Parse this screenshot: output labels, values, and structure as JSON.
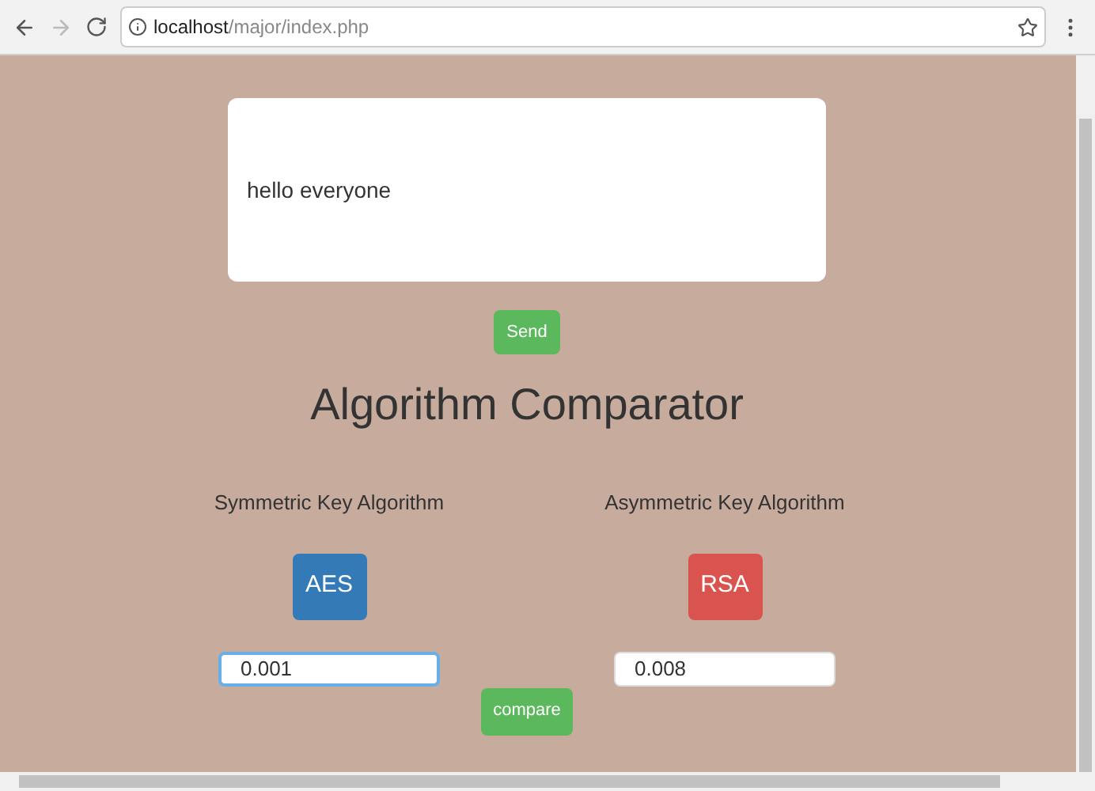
{
  "browser": {
    "url_host": "localhost",
    "url_path": "/major/index.php"
  },
  "message": {
    "value": "hello everyone"
  },
  "send_button": "Send",
  "title": "Algorithm Comparator",
  "columns": [
    {
      "label": "Symmetric Key Algorithm",
      "button": "AES",
      "color": "#337ab7",
      "value": "0.001",
      "focused": true
    },
    {
      "label": "Asymmetric Key Algorithm",
      "button": "RSA",
      "color": "#d9534f",
      "value": "0.008",
      "focused": false
    }
  ],
  "compare_button": "compare"
}
